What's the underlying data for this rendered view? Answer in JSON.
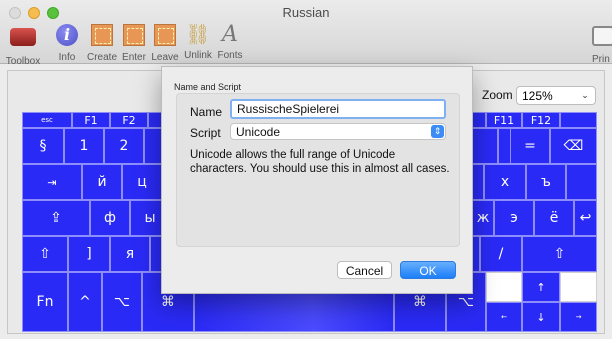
{
  "window": {
    "title": "Russian"
  },
  "toolbar": {
    "toolbox": "Toolbox",
    "info": "Info",
    "create": "Create",
    "enter": "Enter",
    "leave": "Leave",
    "unlink": "Unlink",
    "fonts": "Fonts",
    "print": "Prin",
    "info_glyph": "i",
    "fonts_glyph": "A"
  },
  "zoom": {
    "label": "Zoom",
    "value": "125%"
  },
  "keyboard": {
    "key_color": "#2a2af6",
    "row_fn": {
      "esc": "esc",
      "f1": "F1",
      "f2": "F2",
      "f11": "F11",
      "f12": "F12"
    },
    "row_num": {
      "section": "§",
      "one": "1",
      "two": "2",
      "minus": "–",
      "equals": "=",
      "delete": "⌫"
    },
    "row_q": {
      "tab": "⇥",
      "q": "й",
      "w": "ц",
      "x": "х",
      "hard": "ъ"
    },
    "row_a": {
      "caps": "⇪",
      "a": "ф",
      "s": "ы",
      "zh": "ж",
      "e": "э",
      "yo": "ё",
      "return": "↩"
    },
    "row_z": {
      "shift": "⇧",
      "bracket": "]",
      "ya": "я",
      "slash": "/",
      "shift_right": "⇧"
    },
    "row_bottom": {
      "fn": "Fn",
      "ctrl": "^",
      "opt": "⌥",
      "cmd": "⌘",
      "cmd_right": "⌘",
      "opt_right": "⌥",
      "up": "↑",
      "left": "←",
      "down": "↓",
      "right": "→"
    }
  },
  "dialog": {
    "title": "Name and Script",
    "name_label": "Name",
    "name_value": "RussischeSpielerei",
    "script_label": "Script",
    "script_value": "Unicode",
    "description": "Unicode allows the full range of Unicode characters. You should use this in almost all cases.",
    "cancel": "Cancel",
    "ok": "OK",
    "accent": "#1c7ef8"
  }
}
